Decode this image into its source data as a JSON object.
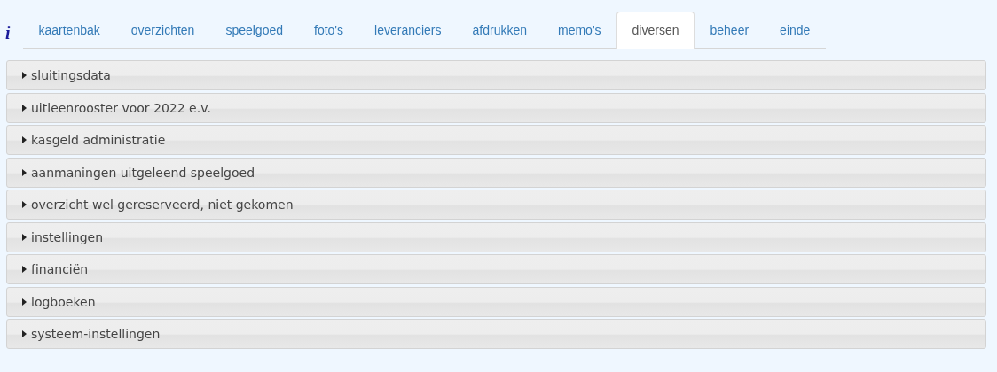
{
  "info_glyph": "i",
  "tabs": [
    {
      "label": "kaartenbak",
      "selected": false
    },
    {
      "label": "overzichten",
      "selected": false
    },
    {
      "label": "speelgoed",
      "selected": false
    },
    {
      "label": "foto's",
      "selected": false
    },
    {
      "label": "leveranciers",
      "selected": false
    },
    {
      "label": "afdrukken",
      "selected": false
    },
    {
      "label": "memo's",
      "selected": false
    },
    {
      "label": "diversen",
      "selected": true
    },
    {
      "label": "beheer",
      "selected": false
    },
    {
      "label": "einde",
      "selected": false
    }
  ],
  "sections": [
    {
      "title": "sluitingsdata",
      "expanded": false
    },
    {
      "title": "uitleenrooster voor 2022 e.v.",
      "expanded": false
    },
    {
      "title": "kasgeld administratie",
      "expanded": false
    },
    {
      "title": "aanmaningen uitgeleend speelgoed",
      "expanded": false
    },
    {
      "title": "overzicht wel gereserveerd, niet gekomen",
      "expanded": false
    },
    {
      "title": "instellingen",
      "expanded": false
    },
    {
      "title": "financiën",
      "expanded": false
    },
    {
      "title": "logboeken",
      "expanded": false
    },
    {
      "title": "systeem-instellingen",
      "expanded": false
    }
  ]
}
